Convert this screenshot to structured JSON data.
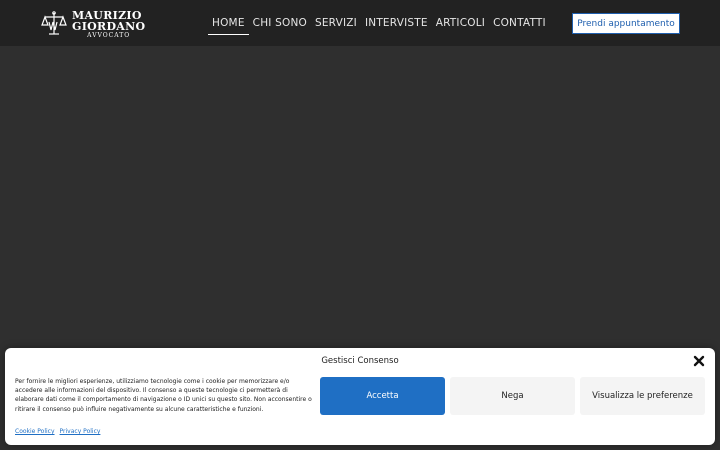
{
  "header": {
    "logo": {
      "line1": "MAURIZIO",
      "line2": "GIORDANO",
      "line3": "AVVOCATO"
    },
    "nav": [
      {
        "label": "HOME",
        "active": true
      },
      {
        "label": "CHI SONO"
      },
      {
        "label": "SERVIZI"
      },
      {
        "label": "INTERVISTE"
      },
      {
        "label": "ARTICOLI"
      },
      {
        "label": "CONTATTI"
      }
    ],
    "cta_label": "Prendi appuntamento"
  },
  "consent": {
    "title": "Gestisci Consenso",
    "text": "Per fornire le migliori esperienze, utilizziamo tecnologie come i cookie per memorizzare e/o accedere alle informazioni del dispositivo. Il consenso a queste tecnologie ci permetterà di elaborare dati come il comportamento di navigazione o ID unici su questo sito. Non acconsentire o ritirare il consenso può influire negativamente su alcune caratteristiche e funzioni.",
    "accept_label": "Accetta",
    "deny_label": "Nega",
    "prefs_label": "Visualizza le preferenze",
    "cookie_policy_label": "Cookie Policy",
    "privacy_policy_label": "Privacy Policy"
  },
  "colors": {
    "header_bg": "#222222",
    "hero_bg": "#2f2f2f",
    "accent": "#1f6fc4"
  },
  "icons": [
    "logo-scales-icon",
    "close-icon"
  ]
}
